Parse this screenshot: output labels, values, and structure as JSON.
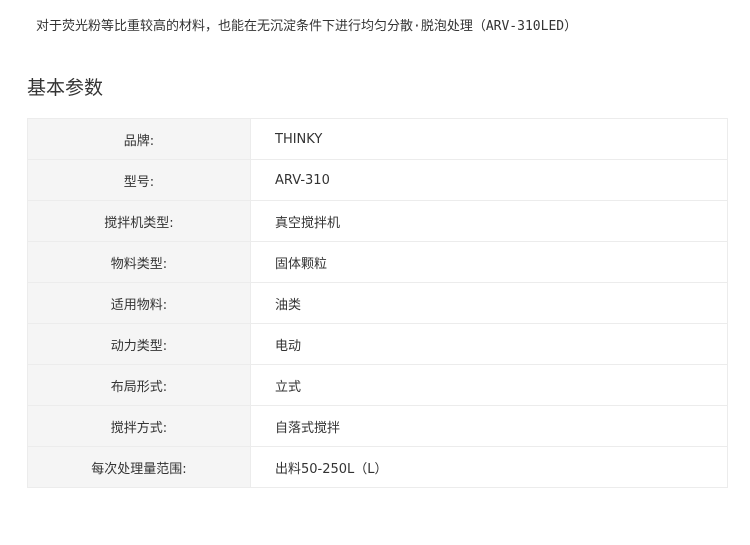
{
  "intro_text": "对于荧光粉等比重较高的材料，也能在无沉淀条件下进行均匀分散·脱泡处理（ARV-310LED）",
  "section_title": "基本参数",
  "params": [
    {
      "label": "品牌:",
      "value": "THINKY"
    },
    {
      "label": "型号:",
      "value": "ARV-310"
    },
    {
      "label": "搅拌机类型:",
      "value": "真空搅拌机"
    },
    {
      "label": "物料类型:",
      "value": "固体颗粒"
    },
    {
      "label": "适用物料:",
      "value": "油类"
    },
    {
      "label": "动力类型:",
      "value": "电动"
    },
    {
      "label": "布局形式:",
      "value": "立式"
    },
    {
      "label": "搅拌方式:",
      "value": "自落式搅拌"
    },
    {
      "label": "每次处理量范围:",
      "value": "出料50-250L（L）"
    }
  ],
  "colors": {
    "text": "#333333",
    "label_bg": "#f5f5f5",
    "border": "#ececec"
  }
}
